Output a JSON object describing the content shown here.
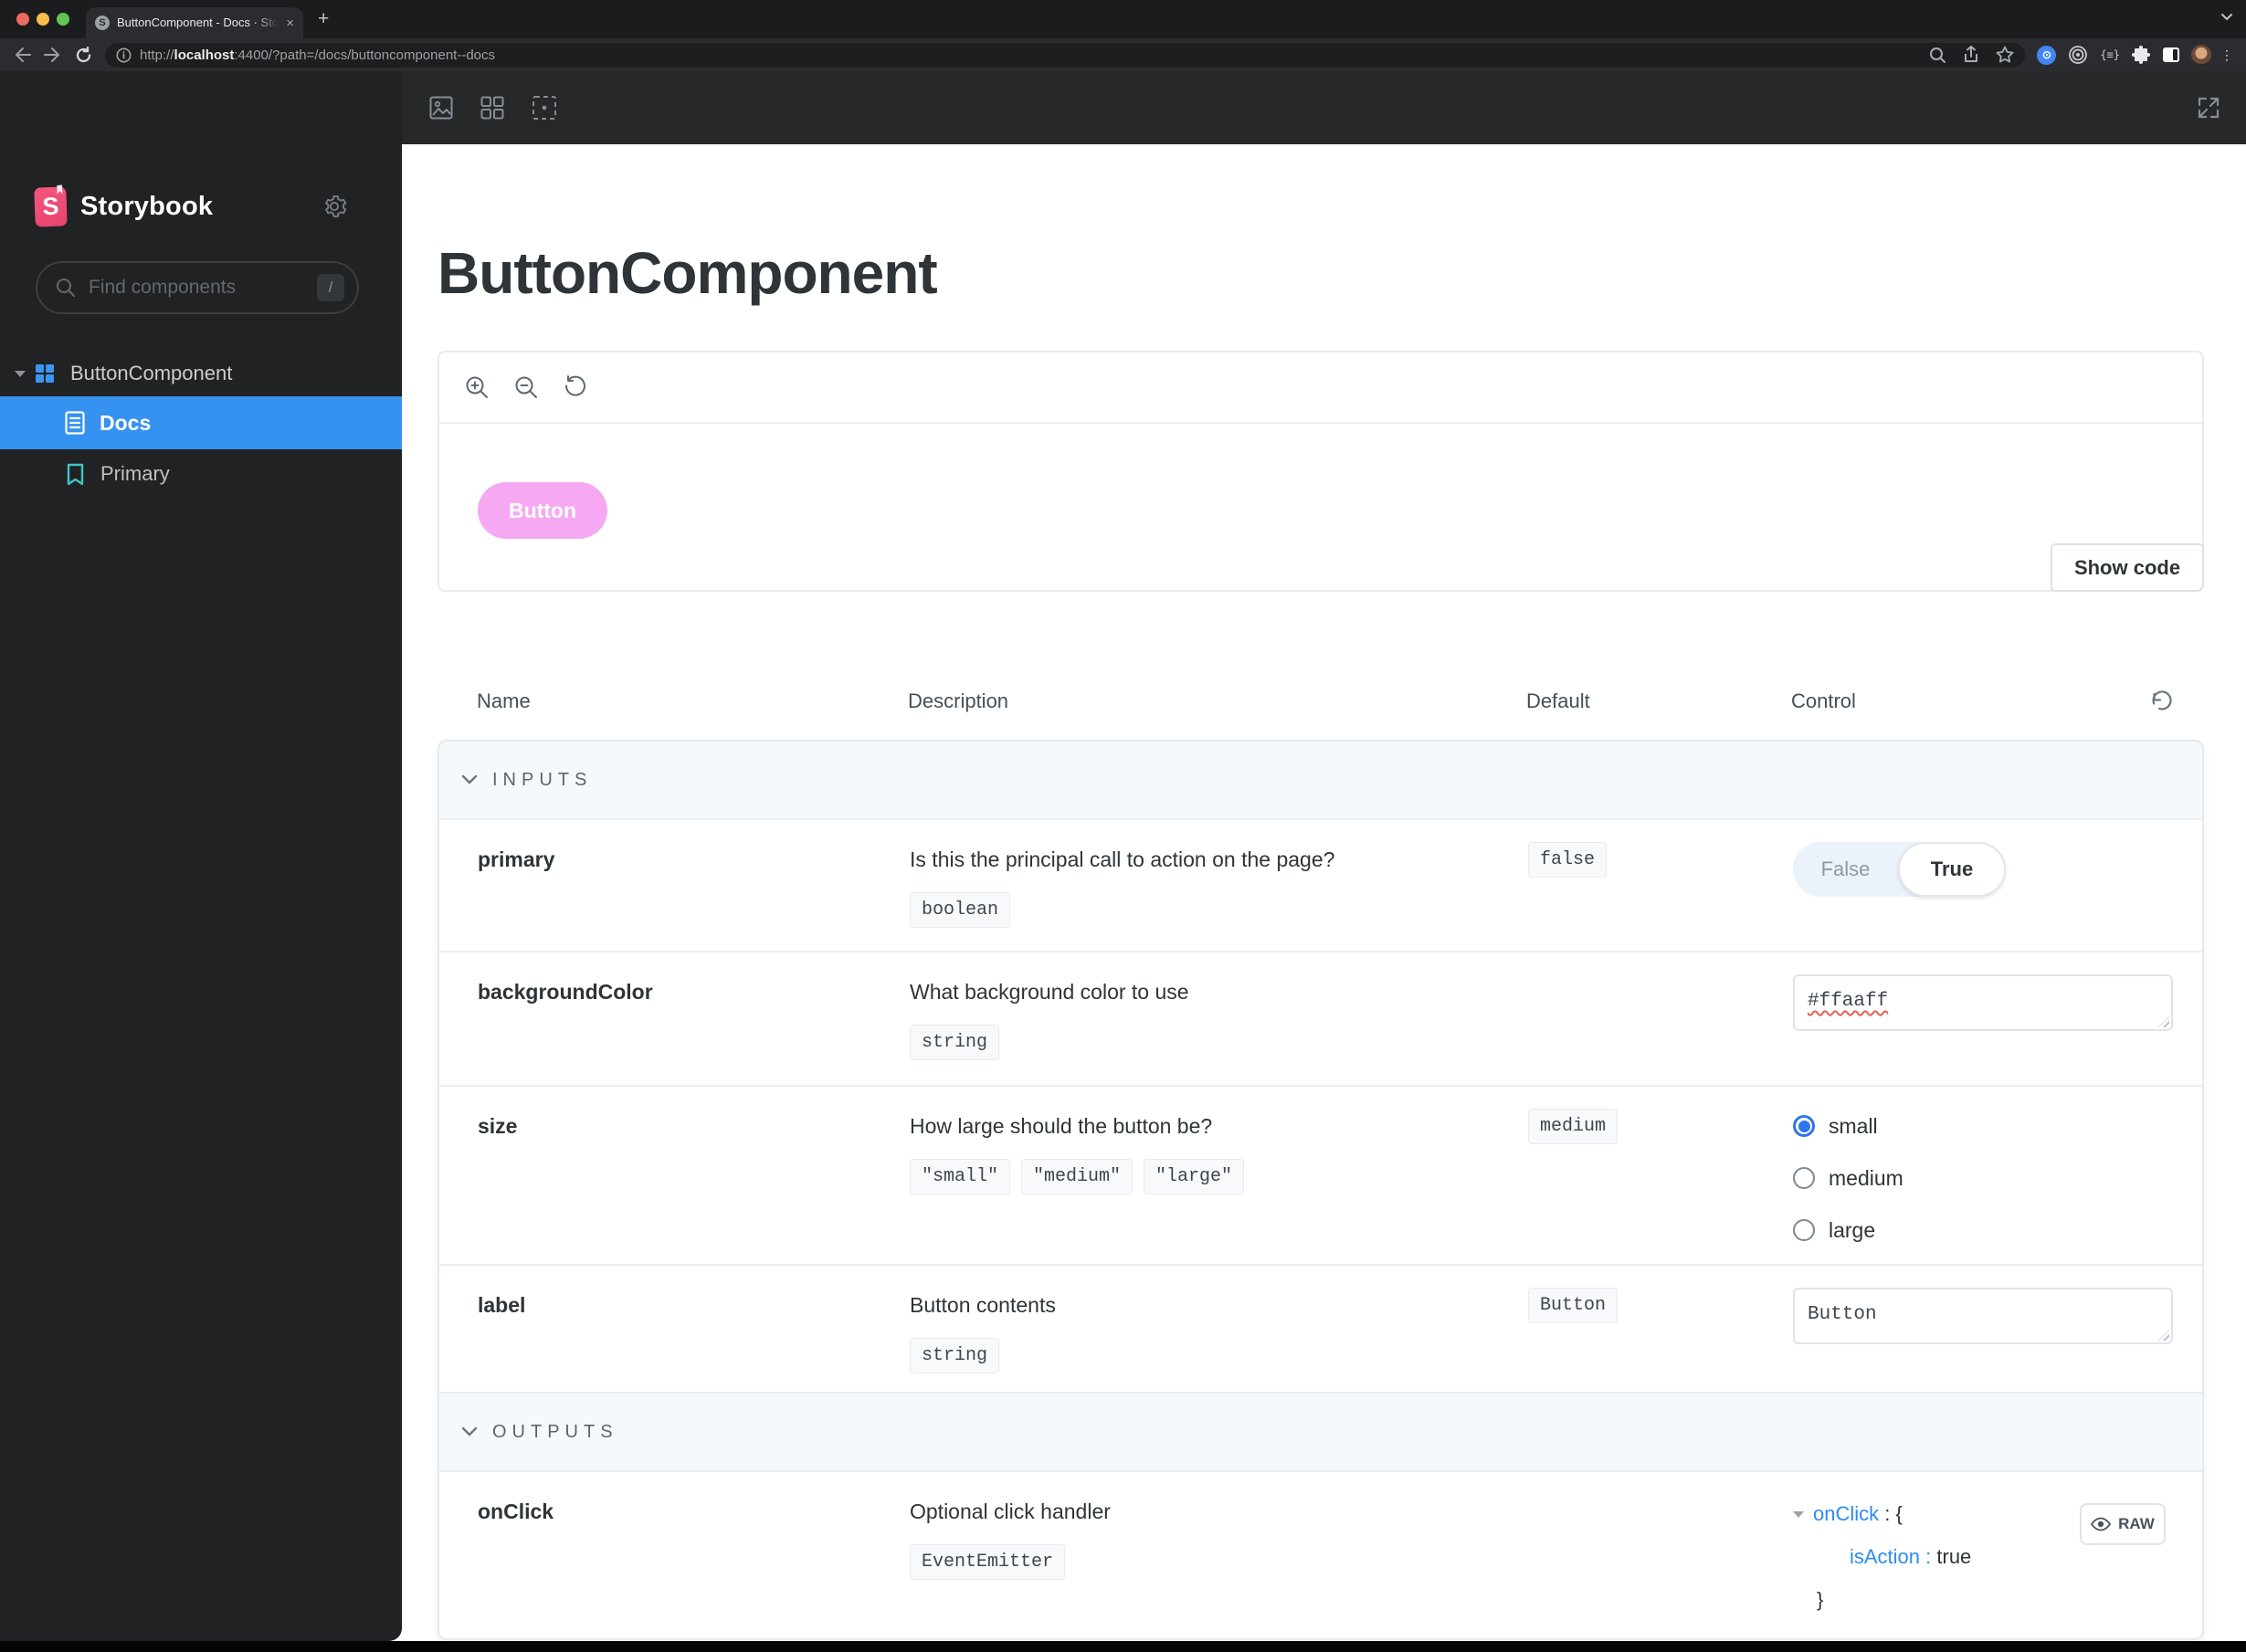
{
  "browser": {
    "tab_title": "ButtonComponent - Docs · Sto",
    "tab_close": "×",
    "new_tab": "+",
    "favicon_letter": "S",
    "url_scheme": "http://",
    "url_host": "localhost",
    "url_rest": ":4400/?path=/docs/buttoncomponent--docs",
    "extension_badge": "{≡}",
    "kebab": "⋮"
  },
  "sidebar": {
    "brand": "Storybook",
    "search_placeholder": "Find components",
    "search_shortcut": "/",
    "root_item": "ButtonComponent",
    "docs_item": "Docs",
    "primary_item": "Primary"
  },
  "doc": {
    "title": "ButtonComponent",
    "preview_button_label": "Button",
    "show_code_label": "Show code"
  },
  "argstable": {
    "headers": {
      "name": "Name",
      "description": "Description",
      "default": "Default",
      "control": "Control"
    },
    "sections": {
      "inputs": "INPUTS",
      "outputs": "OUTPUTS"
    },
    "rows": {
      "primary": {
        "name": "primary",
        "description": "Is this the principal call to action on the page?",
        "type": "boolean",
        "default": "false",
        "toggle_false": "False",
        "toggle_true": "True"
      },
      "backgroundColor": {
        "name": "backgroundColor",
        "description": "What background color to use",
        "type": "string",
        "value": "#ffaaff"
      },
      "size": {
        "name": "size",
        "description": "How large should the button be?",
        "type_options": [
          "\"small\"",
          "\"medium\"",
          "\"large\""
        ],
        "default": "medium",
        "options": [
          "small",
          "medium",
          "large"
        ],
        "selected": "small"
      },
      "label": {
        "name": "label",
        "description": "Button contents",
        "type": "string",
        "default": "Button",
        "value": "Button"
      },
      "onClick": {
        "name": "onClick",
        "description": "Optional click handler",
        "type": "EventEmitter",
        "tree_key": "onClick",
        "tree_open": " : {",
        "tree_subkey": "isAction : ",
        "tree_value": "true",
        "tree_close": "}",
        "raw_label": "RAW"
      }
    }
  },
  "colors": {
    "accent_blue": "#3692f0",
    "link_blue": "#2f8bf2",
    "button_pink": "#f6a9f2",
    "sidebar_bg": "#202224",
    "section_bg": "#f6f9fc",
    "brand_pink": "#ee4c79"
  }
}
